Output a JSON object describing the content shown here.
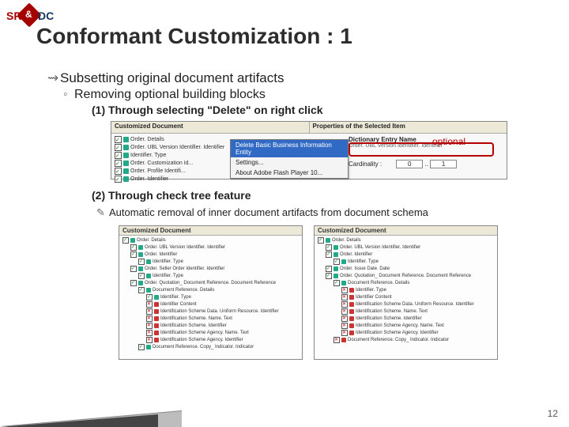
{
  "logo": {
    "left": "SR",
    "amp": "&",
    "right": "DC"
  },
  "title": "Conformant Customization : 1",
  "content": {
    "l1": "Subsetting original document artifacts",
    "l2": "Removing optional building blocks",
    "l3a": "(1) Through selecting \"Delete\" on right click",
    "l3b": "(2) Through check tree feature",
    "l4b": "Automatic removal of inner document artifacts from document schema"
  },
  "fig1": {
    "header_left": "Customized Document",
    "header_right": "Properties of the Selected Item",
    "tree": [
      {
        "checked": true,
        "label": "Order. Details"
      },
      {
        "checked": true,
        "label": "Order. UBL Version Identifier. Identifier"
      },
      {
        "checked": true,
        "label": "Identifier. Type"
      },
      {
        "checked": true,
        "label": "Order. Customization Id..."
      },
      {
        "checked": true,
        "label": "Order. Profile Identifi..."
      },
      {
        "checked": true,
        "label": "Order. Identifier"
      }
    ],
    "ctx": {
      "delete": "Delete Basic Business Information Entity",
      "settings": "Settings...",
      "about": "About Adobe Flash Player 10..."
    },
    "right": {
      "de_label": "Dictionary Entry Name",
      "de_value": "Order. UBL Version Identifier. Identifier",
      "card_label": "Cardinality :",
      "card_min": "0",
      "card_sep": "..",
      "card_max": "1"
    },
    "optional_label": "optional"
  },
  "fig2": {
    "panel_title": "Customized Document",
    "left_tree": [
      {
        "ind": 0,
        "state": "on",
        "ic": "gr",
        "label": "Order. Details"
      },
      {
        "ind": 1,
        "state": "on",
        "ic": "gr",
        "label": "Order. UBL Version Identifier. Identifier"
      },
      {
        "ind": 1,
        "state": "on",
        "ic": "gr",
        "label": "Order. Identifier"
      },
      {
        "ind": 2,
        "state": "on",
        "ic": "gr",
        "label": "Identifier. Type"
      },
      {
        "ind": 1,
        "state": "on",
        "ic": "gr",
        "label": "Order. Seller Order Identifier. Identifier"
      },
      {
        "ind": 2,
        "state": "on",
        "ic": "gr",
        "label": "Identifier. Type"
      },
      {
        "ind": 1,
        "state": "on",
        "ic": "gr",
        "label": "Order. Quotation_ Document Reference. Document Reference"
      },
      {
        "ind": 2,
        "state": "on",
        "ic": "gr",
        "label": "Document Reference. Details"
      },
      {
        "ind": 3,
        "state": "on",
        "ic": "gr",
        "label": "Identifier. Type"
      },
      {
        "ind": 3,
        "state": "off",
        "ic": "red",
        "label": "Identifier Content"
      },
      {
        "ind": 3,
        "state": "off",
        "ic": "red",
        "label": "Identification Scheme Data. Uniform Resource. Identifier"
      },
      {
        "ind": 3,
        "state": "off",
        "ic": "red",
        "label": "Identification Scheme. Name. Text"
      },
      {
        "ind": 3,
        "state": "off",
        "ic": "red",
        "label": "Identification Scheme. Identifier"
      },
      {
        "ind": 3,
        "state": "off",
        "ic": "red",
        "label": "Identification Scheme Agency. Name. Text"
      },
      {
        "ind": 3,
        "state": "off",
        "ic": "red",
        "label": "Identification Scheme Agency. Identifier"
      },
      {
        "ind": 2,
        "state": "on",
        "ic": "gr",
        "label": "Document Reference. Copy_ Indicator. Indicator"
      }
    ],
    "right_tree": [
      {
        "ind": 0,
        "state": "on",
        "ic": "gr",
        "label": "Order. Details"
      },
      {
        "ind": 1,
        "state": "on",
        "ic": "gr",
        "label": "Order. UBL Version Identifier. Identifier"
      },
      {
        "ind": 1,
        "state": "on",
        "ic": "gr",
        "label": "Order. Identifier"
      },
      {
        "ind": 2,
        "state": "on",
        "ic": "gr",
        "label": "Identifier. Type"
      },
      {
        "ind": 1,
        "state": "on",
        "ic": "gr",
        "label": "Order. Issue Date. Date"
      },
      {
        "ind": 1,
        "state": "on",
        "ic": "gr",
        "label": "Order. Quotation_ Document Reference. Document Reference"
      },
      {
        "ind": 2,
        "state": "on",
        "ic": "gr",
        "label": "Document Reference. Details"
      },
      {
        "ind": 3,
        "state": "off",
        "ic": "red",
        "label": "Identifier. Type"
      },
      {
        "ind": 3,
        "state": "off",
        "ic": "red",
        "label": "Identifier Content"
      },
      {
        "ind": 3,
        "state": "off",
        "ic": "red",
        "label": "Identification Scheme Data. Uniform Resource. Identifier"
      },
      {
        "ind": 3,
        "state": "off",
        "ic": "red",
        "label": "Identification Scheme. Name. Text"
      },
      {
        "ind": 3,
        "state": "off",
        "ic": "red",
        "label": "Identification Scheme. Identifier"
      },
      {
        "ind": 3,
        "state": "off",
        "ic": "red",
        "label": "Identification Scheme Agency. Name. Text"
      },
      {
        "ind": 3,
        "state": "off",
        "ic": "red",
        "label": "Identification Scheme Agency. Identifier"
      },
      {
        "ind": 2,
        "state": "off",
        "ic": "red",
        "label": "Document Reference. Copy_ Indicator. Indicator"
      }
    ]
  },
  "page_number": "12"
}
